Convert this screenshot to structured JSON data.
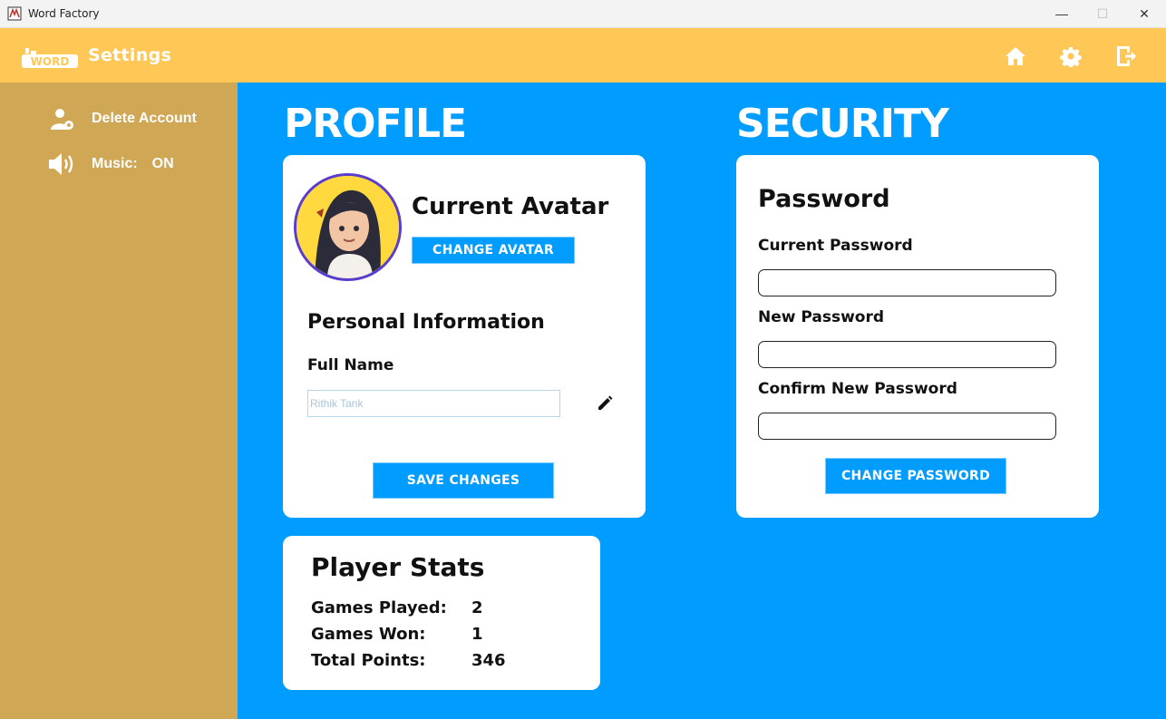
{
  "window": {
    "title": "Word Factory",
    "minimize": "—",
    "maximize": "☐",
    "close": "✕"
  },
  "header": {
    "logo_text": "WORD",
    "page_title": "Settings"
  },
  "sidebar": {
    "delete_account": "Delete Account",
    "music_label": "Music:",
    "music_value": "ON"
  },
  "profile": {
    "section_title": "PROFILE",
    "current_avatar": "Current Avatar",
    "change_avatar_btn": "CHANGE AVATAR",
    "personal_info": "Personal Information",
    "full_name_label": "Full Name",
    "full_name_placeholder": "Rithik Tank",
    "save_btn": "SAVE CHANGES"
  },
  "security": {
    "section_title": "SECURITY",
    "password_heading": "Password",
    "current_password_label": "Current Password",
    "new_password_label": "New Password",
    "confirm_password_label": "Confirm New Password",
    "change_password_btn": "CHANGE PASSWORD"
  },
  "stats": {
    "heading": "Player Stats",
    "games_played_label": "Games Played:",
    "games_played": "2",
    "games_won_label": "Games Won:",
    "games_won": "1",
    "total_points_label": "Total Points:",
    "total_points": "346"
  },
  "colors": {
    "header": "#ffc755",
    "sidebar": "#d0a755",
    "main": "#009cff",
    "button": "#009cff",
    "avatar_ring": "#5a3ccf"
  }
}
